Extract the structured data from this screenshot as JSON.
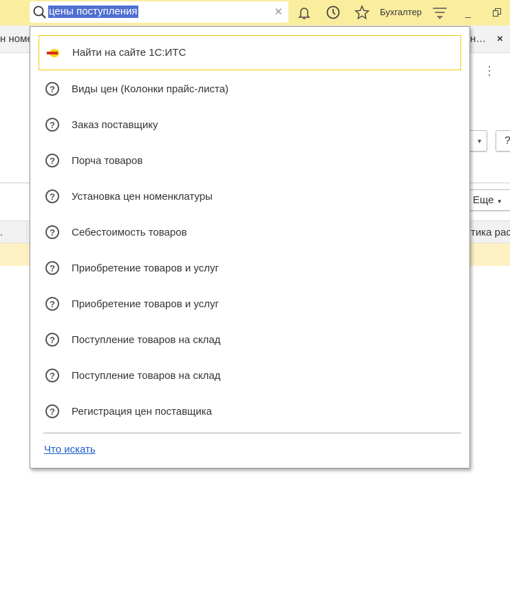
{
  "search": {
    "value": "цены поступления"
  },
  "topbar": {
    "user": "Бухгалтер"
  },
  "tabs": {
    "left_fragment": "н номе",
    "right_fragment": "н…",
    "close": "×"
  },
  "background": {
    "more_button": "Еще",
    "column_fragment": "тика рас",
    "help": "?",
    "left_header": "."
  },
  "dropdown": {
    "items": [
      {
        "label": "Найти на сайте 1С:ИТС",
        "icon": "its-logo-icon"
      },
      {
        "label": "Виды цен (Колонки прайс-листа)",
        "icon": "help-icon"
      },
      {
        "label": "Заказ поставщику",
        "icon": "help-icon"
      },
      {
        "label": "Порча товаров",
        "icon": "help-icon"
      },
      {
        "label": "Установка цен номенклатуры",
        "icon": "help-icon"
      },
      {
        "label": "Себестоимость товаров",
        "icon": "help-icon"
      },
      {
        "label": "Приобретение товаров и услуг",
        "icon": "help-icon"
      },
      {
        "label": "Приобретение товаров и услуг",
        "icon": "help-icon"
      },
      {
        "label": "Поступление товаров на склад",
        "icon": "help-icon"
      },
      {
        "label": "Поступление товаров на склад",
        "icon": "help-icon"
      },
      {
        "label": "Регистрация цен поставщика",
        "icon": "help-icon"
      }
    ],
    "footer_link": "Что искать"
  },
  "colors": {
    "topbar": "#fbed9e",
    "selection": "#4f6fd1",
    "link": "#1b5ec9",
    "active_border": "#f0c800",
    "row_highlight": "#fdf1c4"
  }
}
